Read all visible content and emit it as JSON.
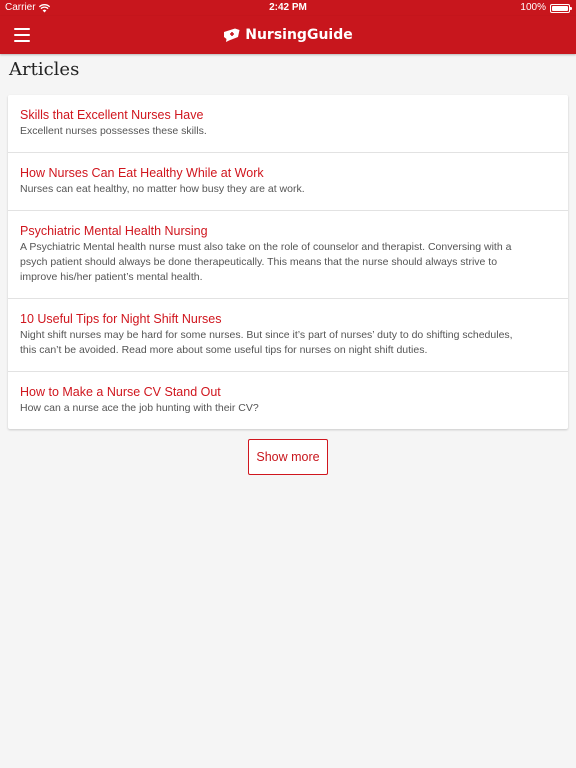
{
  "status_bar": {
    "carrier": "Carrier",
    "time": "2:42 PM",
    "battery": "100%"
  },
  "header": {
    "brand": "NursingGuide",
    "menu_icon": "hamburger-menu-icon",
    "logo_icon": "nursing-guide-logo-icon",
    "background_color": "#c8161d"
  },
  "page": {
    "title": "Articles"
  },
  "articles": [
    {
      "title": "Skills that Excellent Nurses Have",
      "summary": "Excellent nurses possesses these skills."
    },
    {
      "title": "How Nurses Can Eat Healthy While at Work",
      "summary": "Nurses can eat healthy, no matter how busy they are at work."
    },
    {
      "title": "Psychiatric Mental Health Nursing",
      "summary": "A Psychiatric Mental health nurse must also take on the role of counselor and therapist. Conversing with a psych patient should always be done therapeutically. This means that the nurse should always strive to improve his/her patient’s mental health."
    },
    {
      "title": "10 Useful Tips for Night Shift Nurses",
      "summary": "Night shift nurses may be hard for some nurses. But since it’s part of nurses’ duty to do shifting schedules, this can’t be avoided. Read more about some useful tips for nurses on night shift duties."
    },
    {
      "title": "How to Make a Nurse CV Stand Out",
      "summary": "How can a nurse ace the job hunting with their CV?"
    }
  ],
  "actions": {
    "show_more_label": "Show more"
  }
}
